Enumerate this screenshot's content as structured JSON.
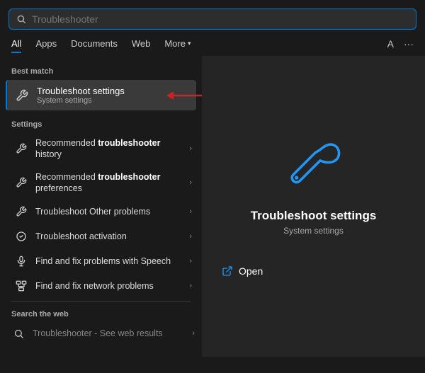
{
  "search": {
    "value": "Troubleshooter",
    "placeholder": "Troubleshooter"
  },
  "nav": {
    "tabs": [
      {
        "id": "all",
        "label": "All",
        "active": true
      },
      {
        "id": "apps",
        "label": "Apps",
        "active": false
      },
      {
        "id": "documents",
        "label": "Documents",
        "active": false
      },
      {
        "id": "web",
        "label": "Web",
        "active": false
      },
      {
        "id": "more",
        "label": "More",
        "active": false
      }
    ],
    "right": {
      "a_label": "A",
      "dots_label": "···"
    }
  },
  "best_match": {
    "label": "Best match",
    "item": {
      "title_plain": "Troubleshoot settings",
      "title_bold_part": "",
      "subtitle": "System settings"
    }
  },
  "settings": {
    "label": "Settings",
    "items": [
      {
        "id": "rec-history",
        "text_before": "Recommended ",
        "text_bold": "troubleshooter",
        "text_after": " history",
        "icon": "wrench"
      },
      {
        "id": "rec-prefs",
        "text_before": "Recommended ",
        "text_bold": "troubleshooter",
        "text_after": " preferences",
        "icon": "wrench"
      },
      {
        "id": "other-problems",
        "text_before": "Troubleshoot Other problems",
        "text_bold": "",
        "text_after": "",
        "icon": "wrench"
      },
      {
        "id": "activation",
        "text_before": "Troubleshoot activation",
        "text_bold": "",
        "text_after": "",
        "icon": "circle-check"
      },
      {
        "id": "speech",
        "text_before": "Find and fix problems with Speech",
        "text_bold": "",
        "text_after": "",
        "icon": "mic"
      },
      {
        "id": "network",
        "text_before": "Find and fix network problems",
        "text_bold": "",
        "text_after": "",
        "icon": "network"
      }
    ]
  },
  "web_search": {
    "label": "Search the web",
    "item_text": "Troubleshooter",
    "item_suffix": " - See web results"
  },
  "right_panel": {
    "title": "Troubleshoot settings",
    "subtitle": "System settings",
    "open_label": "Open"
  }
}
